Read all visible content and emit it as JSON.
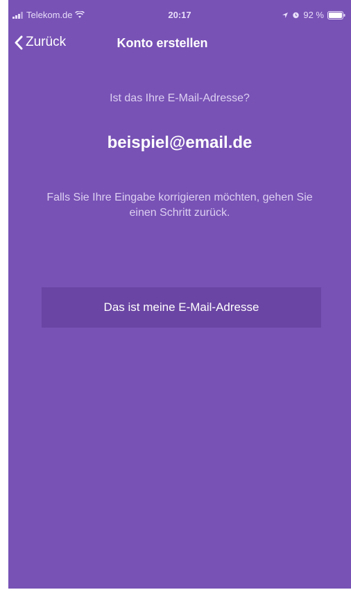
{
  "status_bar": {
    "carrier": "Telekom.de",
    "time": "20:17",
    "battery": "92 %",
    "icons": [
      "signal-icon",
      "wifi-icon",
      "location-icon",
      "alarm-icon",
      "battery-icon"
    ]
  },
  "nav": {
    "back_label": "Zurück",
    "title": "Konto erstellen"
  },
  "content": {
    "question": "Ist das Ihre E-Mail-Adresse?",
    "email": "beispiel@email.de",
    "hint": "Falls Sie Ihre Eingabe korrigieren möchten, gehen Sie einen Schritt zurück."
  },
  "actions": {
    "confirm_label": "Das ist meine E-Mail-Adresse"
  },
  "colors": {
    "background": "#7852b5",
    "button": "#6a45a3",
    "text": "#ffffff"
  }
}
